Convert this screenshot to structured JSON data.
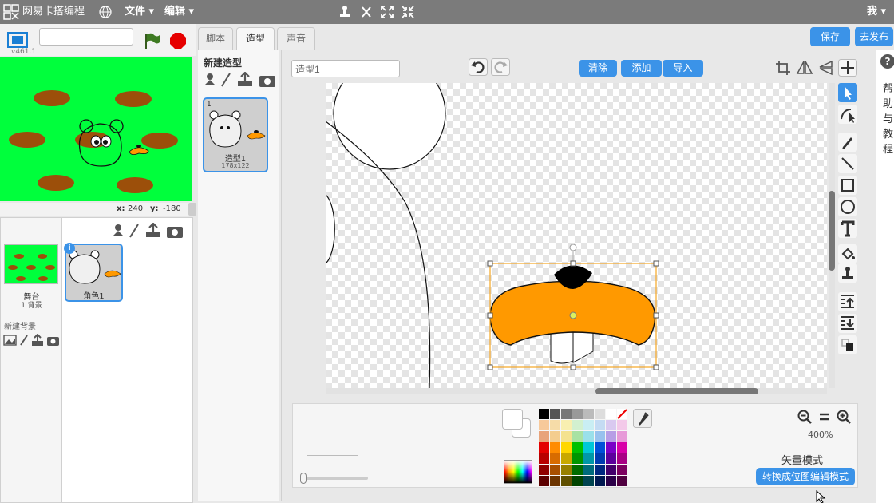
{
  "menubar": {
    "app_title": "网易卡搭编程",
    "file_menu": "文件 ▾",
    "edit_menu": "编辑 ▾",
    "user": "我 ▾"
  },
  "stage": {
    "version": "v461.1",
    "name_value": "",
    "coord_x_label": "x:",
    "coord_x": "240",
    "coord_y_label": "y:",
    "coord_y": "-180"
  },
  "sprites": {
    "stage_label": "舞台",
    "stage_bg_count": "1 背景",
    "new_backdrop": "新建背景",
    "sprite1_name": "角色1",
    "sprite1_badge": "i"
  },
  "tabs": [
    "脚本",
    "造型",
    "声音"
  ],
  "top_buttons": {
    "save": "保存",
    "publish": "去发布"
  },
  "costumes": {
    "new_costume": "新建造型",
    "items": [
      {
        "index": "1",
        "name": "造型1",
        "size": "178x122"
      }
    ]
  },
  "editor": {
    "costume_name": "造型1",
    "clear": "清除",
    "add": "添加",
    "import": "导入",
    "zoom": "400%",
    "mode_label": "矢量模式",
    "convert_button": "转换成位图编辑模式"
  },
  "help": {
    "title": "帮助与教程",
    "icon": "?"
  },
  "colors": {
    "accent": "#3b93e8",
    "stage_green": "#00ff3c",
    "hole_brown": "#9c4f0a",
    "beak_orange": "#ff9900"
  }
}
